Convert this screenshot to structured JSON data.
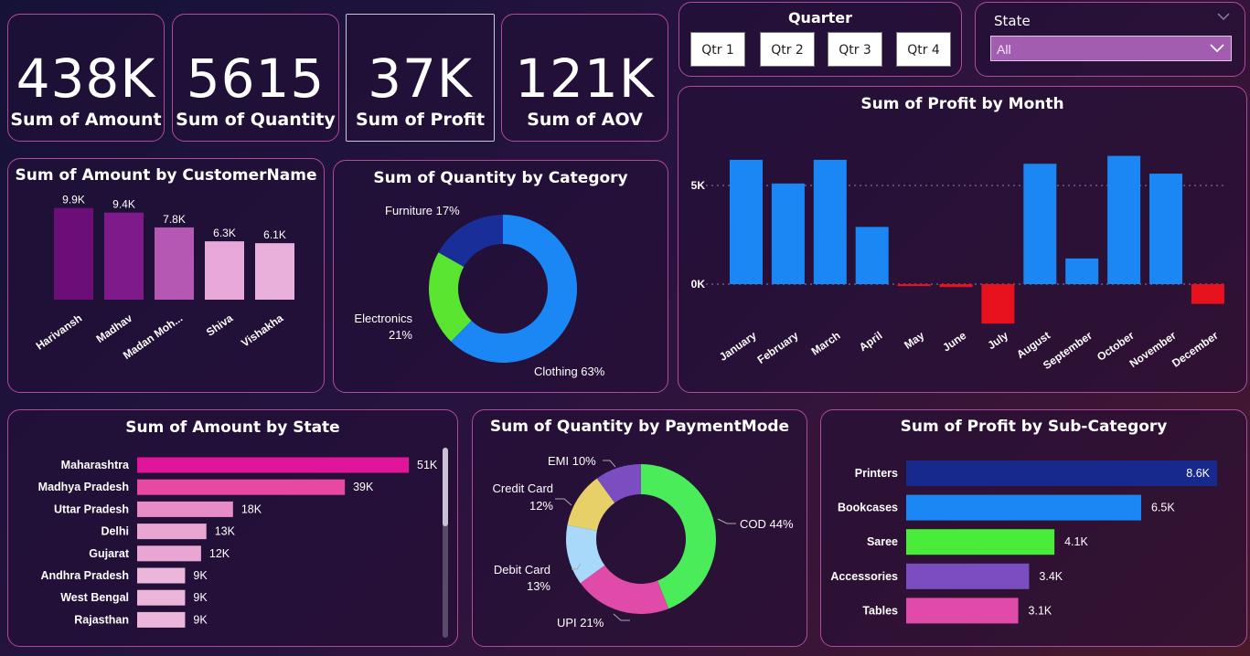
{
  "kpis": [
    {
      "value": "438K",
      "label": "Sum of Amount"
    },
    {
      "value": "5615",
      "label": "Sum of Quantity"
    },
    {
      "value": "37K",
      "label": "Sum of Profit"
    },
    {
      "value": "121K",
      "label": "Sum of AOV"
    }
  ],
  "quarter": {
    "title": "Quarter",
    "options": [
      "Qtr 1",
      "Qtr 2",
      "Qtr 3",
      "Qtr 4"
    ]
  },
  "state_filter": {
    "title": "State",
    "selected": "All"
  },
  "chart_data": [
    {
      "id": "amount_by_customer",
      "type": "bar",
      "title": "Sum of Amount by CustomerName",
      "categories": [
        "Harivansh",
        "Madhav",
        "Madan Moh...",
        "Shiva",
        "Vishakha"
      ],
      "values": [
        9900,
        9400,
        7800,
        6300,
        6100
      ],
      "data_labels": [
        "9.9K",
        "9.4K",
        "7.8K",
        "6.3K",
        "6.1K"
      ],
      "colors": [
        "#6c0e78",
        "#7f1a8a",
        "#b458b4",
        "#e8a8d8",
        "#eab0dc"
      ],
      "ylim": [
        0,
        11500
      ]
    },
    {
      "id": "quantity_by_category",
      "type": "pie",
      "title": "Sum of Quantity by Category",
      "labels": [
        "Clothing",
        "Electronics",
        "Furniture"
      ],
      "values": [
        63,
        21,
        17
      ],
      "slice_labels": [
        "Clothing 63%",
        "Electronics 21%",
        "Furniture 17%"
      ],
      "colors": [
        "#1a87f5",
        "#5ae630",
        "#1a2e9a"
      ]
    },
    {
      "id": "profit_by_month",
      "type": "bar",
      "title": "Sum of Profit by Month",
      "categories": [
        "January",
        "February",
        "March",
        "April",
        "May",
        "June",
        "July",
        "August",
        "September",
        "October",
        "November",
        "December"
      ],
      "values": [
        6300,
        5100,
        6300,
        2900,
        -100,
        -150,
        -2000,
        6100,
        1300,
        6500,
        5600,
        -1000
      ],
      "yticks": [
        "5K",
        "0K"
      ],
      "ytick_values": [
        5000,
        0
      ],
      "ylim": [
        -2500,
        8000
      ],
      "colors": {
        "positive": "#1a87f5",
        "negative": "#e8121e"
      }
    },
    {
      "id": "amount_by_state",
      "type": "bar",
      "title": "Sum of Amount by State",
      "categories": [
        "Maharashtra",
        "Madhya Pradesh",
        "Uttar Pradesh",
        "Delhi",
        "Gujarat",
        "Andhra Pradesh",
        "West Bengal",
        "Rajasthan"
      ],
      "values": [
        51000,
        39000,
        18000,
        13000,
        12000,
        9000,
        9000,
        9000
      ],
      "data_labels": [
        "51K",
        "39K",
        "18K",
        "13K",
        "12K",
        "9K",
        "9K",
        "9K"
      ],
      "colors": [
        "#e0159a",
        "#e8489f",
        "#e88cc8",
        "#eaa6d2",
        "#eaa6d2",
        "#ecb6da",
        "#ecb6da",
        "#ecb6da"
      ],
      "xlim": [
        0,
        51000
      ]
    },
    {
      "id": "quantity_by_paymentmode",
      "type": "pie",
      "title": "Sum of Quantity by PaymentMode",
      "labels": [
        "COD",
        "UPI",
        "Debit Card",
        "Credit Card",
        "EMI"
      ],
      "values": [
        44,
        21,
        13,
        12,
        10
      ],
      "slice_labels": [
        "COD 44%",
        "UPI 21%",
        "Debit Card 13%",
        "Credit Card 12%",
        "EMI 10%"
      ],
      "colors": [
        "#4aec5a",
        "#e04aa8",
        "#a8d8fa",
        "#e8d068",
        "#7a4ec0"
      ]
    },
    {
      "id": "profit_by_subcategory",
      "type": "bar",
      "title": "Sum of Profit by Sub-Category",
      "categories": [
        "Printers",
        "Bookcases",
        "Saree",
        "Accessories",
        "Tables"
      ],
      "values": [
        8600,
        6500,
        4100,
        3400,
        3100
      ],
      "data_labels": [
        "8.6K",
        "6.5K",
        "4.1K",
        "3.4K",
        "3.1K"
      ],
      "colors": [
        "#18298e",
        "#1a87f5",
        "#4aec3a",
        "#7a4ec0",
        "#e04aa8"
      ],
      "xlim": [
        0,
        8600
      ]
    }
  ]
}
